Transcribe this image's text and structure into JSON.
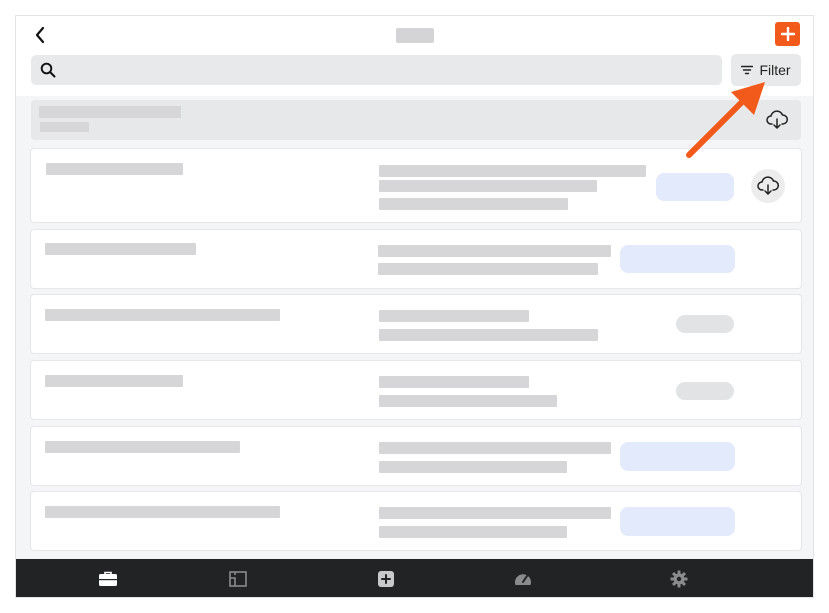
{
  "header": {
    "title": ""
  },
  "search": {
    "placeholder": ""
  },
  "toolbar": {
    "filter_label": "Filter"
  },
  "colors": {
    "accent": "#f25a1b",
    "nav_background": "#222324",
    "nav_active": "#ffffff",
    "nav_inactive": "#8a8b8d",
    "pill_blue": "#e3eafb",
    "placeholder": "#d6d6d8"
  },
  "icons": {
    "back": "chevron-left-icon",
    "add": "plus-icon",
    "search": "search-icon",
    "filter": "filter-lines-icon",
    "download": "cloud-download-icon",
    "nav": [
      "briefcase-icon",
      "floor-plan-icon",
      "plus-square-icon",
      "speedometer-icon",
      "gear-icon"
    ],
    "annotation": "orange-arrow-pointing-to-filter"
  }
}
